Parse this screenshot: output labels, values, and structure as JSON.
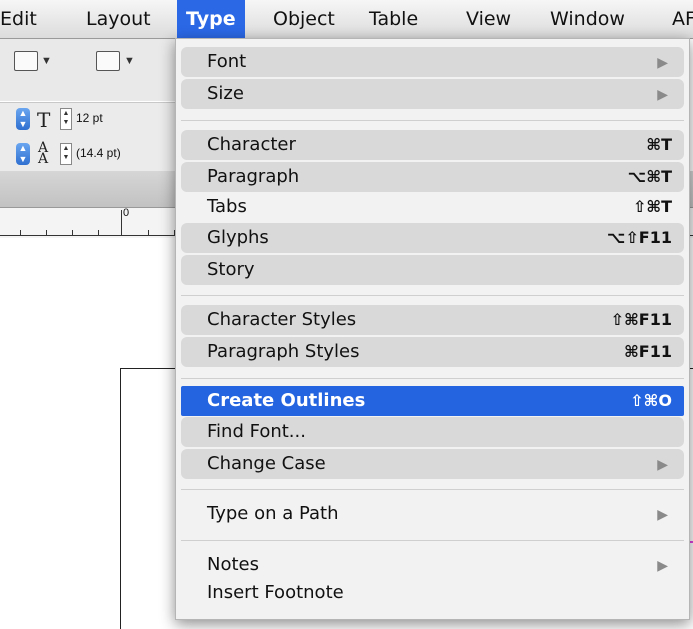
{
  "menubar": {
    "items": [
      {
        "label": "Edit"
      },
      {
        "label": "Layout"
      },
      {
        "label": "Type",
        "active": true
      },
      {
        "label": "Object"
      },
      {
        "label": "Table"
      },
      {
        "label": "View"
      },
      {
        "label": "Window"
      },
      {
        "label": "AF"
      }
    ]
  },
  "toolbar": {
    "font_size": "12 pt",
    "leading": "(14.4 pt)"
  },
  "ruler": {
    "zero_label": "0"
  },
  "type_menu": {
    "items": [
      {
        "label": "Font",
        "shortcut": "",
        "submenu": true
      },
      {
        "label": "Size",
        "shortcut": "",
        "submenu": true
      },
      {
        "label": "Character",
        "shortcut": "⌘T",
        "submenu": false
      },
      {
        "label": "Paragraph",
        "shortcut": "⌥⌘T",
        "submenu": false
      },
      {
        "label": "Tabs",
        "shortcut": "⇧⌘T",
        "submenu": false
      },
      {
        "label": "Glyphs",
        "shortcut": "⌥⇧F11",
        "submenu": false
      },
      {
        "label": "Story",
        "shortcut": "",
        "submenu": false
      },
      {
        "label": "Character Styles",
        "shortcut": "⇧⌘F11",
        "submenu": false
      },
      {
        "label": "Paragraph Styles",
        "shortcut": "⌘F11",
        "submenu": false
      },
      {
        "label": "Create Outlines",
        "shortcut": "⇧⌘O",
        "submenu": false,
        "highlighted": true
      },
      {
        "label": "Find Font...",
        "shortcut": "",
        "submenu": false
      },
      {
        "label": "Change Case",
        "shortcut": "",
        "submenu": true
      },
      {
        "label": "Type on a Path",
        "shortcut": "",
        "submenu": true
      },
      {
        "label": "Notes",
        "shortcut": "",
        "submenu": true
      },
      {
        "label": "Insert Footnote",
        "shortcut": "",
        "submenu": false
      }
    ]
  },
  "colors": {
    "highlight": "#2464e0",
    "menubar_active": "#2b68e6"
  }
}
